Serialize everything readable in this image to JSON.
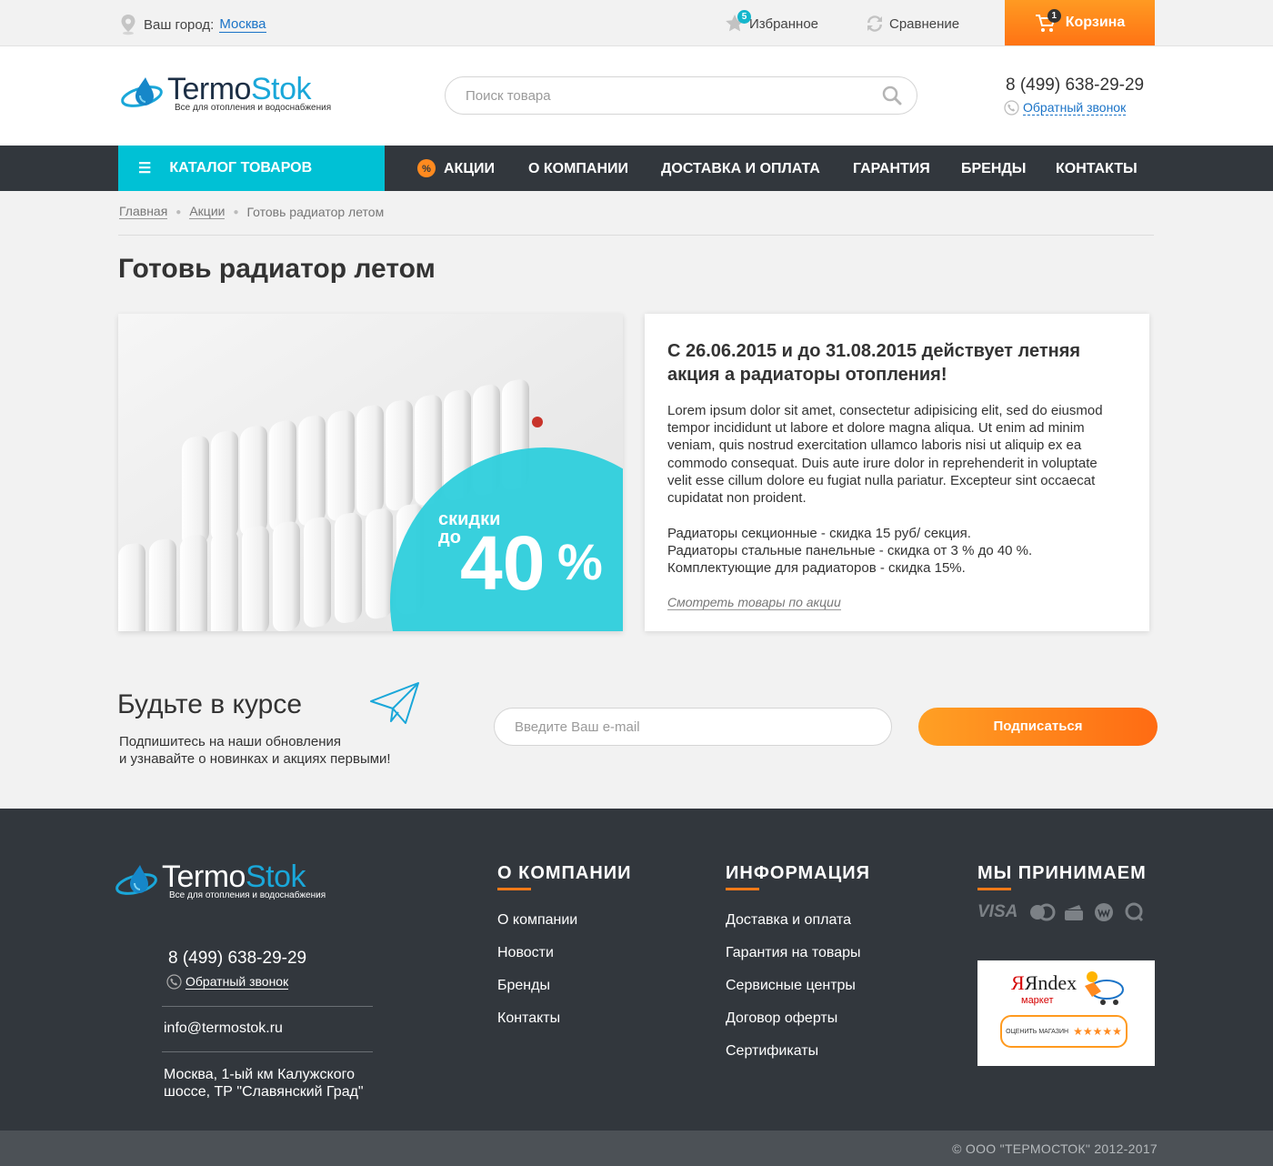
{
  "topbar": {
    "city_label": "Ваш город:",
    "city_value": "Москва",
    "favorites_label": "Избранное",
    "favorites_count": "5",
    "compare_label": "Сравнение",
    "cart_label": "Корзина",
    "cart_count": "1"
  },
  "header": {
    "logo_part1": "Termo",
    "logo_part2": "Stok",
    "logo_tagline": "Все для отопления и водоснабжения",
    "search_placeholder": "Поиск товара",
    "phone": "8 (499) 638-29-29",
    "callback": "Обратный звонок"
  },
  "nav": {
    "catalog": "КАТАЛОГ ТОВАРОВ",
    "items": [
      "АКЦИИ",
      "О КОМПАНИИ",
      "ДОСТАВКА И ОПЛАТА",
      "ГАРАНТИЯ",
      "БРЕНДЫ",
      "КОНТАКТЫ"
    ]
  },
  "breadcrumbs": [
    "Главная",
    "Акции",
    "Готовь радиатор летом"
  ],
  "page_title": "Готовь радиатор летом",
  "banner": {
    "line1": "скидки",
    "line2": "до",
    "value": "40",
    "unit": "%"
  },
  "promo": {
    "heading": "С 26.06.2015 и до 31.08.2015 действует летняя акция а радиаторы отопления!",
    "paragraph": "Lorem ipsum dolor sit amet, consectetur adipisicing elit, sed do eiusmod tempor incididunt ut labore et dolore magna aliqua. Ut enim ad minim veniam, quis nostrud exercitation ullamco laboris nisi ut aliquip ex ea commodo consequat. Duis aute irure dolor in reprehenderit in voluptate velit esse cillum dolore eu fugiat nulla pariatur. Excepteur sint occaecat cupidatat non proident.",
    "list": [
      "Радиаторы секционные - скидка 15 руб/ секция.",
      "Радиаторы стальные панельные - скидка от 3 % до 40 %.",
      "Комплектующие для радиаторов - скидка 15%."
    ],
    "link": "Смотреть товары по акции"
  },
  "subscribe": {
    "title": "Будьте в курсе",
    "text_line1": "Подпишитесь на наши обновления",
    "text_line2": "и узнавайте о новинках и акциях первыми!",
    "email_placeholder": "Введите Ваш e-mail",
    "button": "Подписаться"
  },
  "footer": {
    "phone": "8 (499) 638-29-29",
    "callback": "Обратный звонок",
    "email": "info@termostok.ru",
    "address": "Москва, 1-ый км Калужского шоссе, ТР \"Славянский Град\"",
    "col1_title": "О КОМПАНИИ",
    "col1_links": [
      "О компании",
      "Новости",
      "Бренды",
      "Контакты"
    ],
    "col2_title": "ИНФОРМАЦИЯ",
    "col2_links": [
      "Доставка и оплата",
      "Гарантия на товары",
      "Сервисные центры",
      "Договор оферты",
      "Сертификаты"
    ],
    "col3_title": "МЫ ПРИНИМАЕМ",
    "payment_visa": "VISA",
    "ym_brand": "Яndex",
    "ym_sub": "маркет",
    "ym_rate": "ОЦЕНИТЬ МАГАЗИН",
    "ym_stars": "★★★★★",
    "copyright": "© ООО \"ТЕРМОСТОК\" 2012-2017"
  },
  "colors": {
    "accent_orange": "#ff7a18",
    "accent_cyan": "#00c1d5",
    "nav_dark": "#32373d",
    "link_blue": "#1a73c7"
  }
}
